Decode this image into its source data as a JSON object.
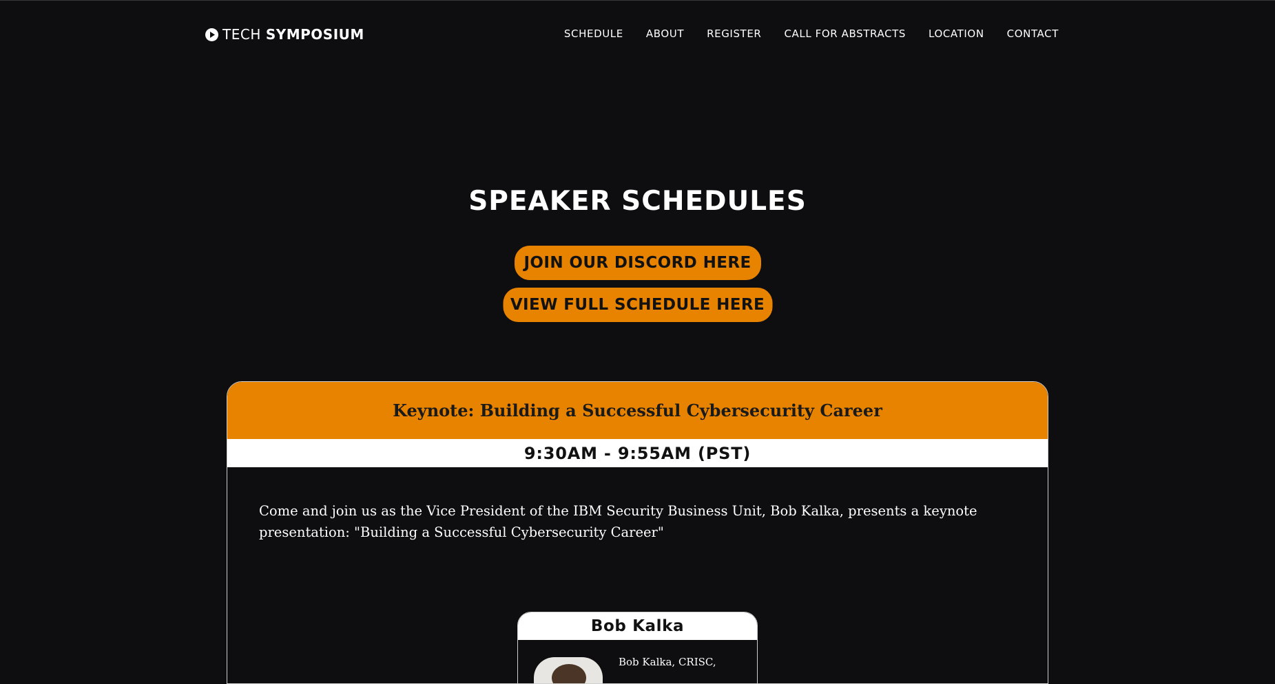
{
  "header": {
    "logo_light": "TECH",
    "logo_bold": "SYMPOSIUM",
    "logo_icon": "play-circle-icon",
    "nav": [
      "SCHEDULE",
      "ABOUT",
      "REGISTER",
      "CALL FOR ABSTRACTS",
      "LOCATION",
      "CONTACT"
    ]
  },
  "main": {
    "title": "SPEAKER SCHEDULES",
    "discord_button": "JOIN OUR DISCORD HERE",
    "schedule_button": "VIEW FULL SCHEDULE HERE"
  },
  "session": {
    "title": "Keynote: Building a Successful Cybersecurity Career",
    "time": "9:30AM - 9:55AM (PST)",
    "description": "Come and join us as the Vice President of the IBM Security Business Unit, Bob Kalka, presents a keynote presentation: \"Building a Successful Cybersecurity Career\"",
    "speaker": {
      "name": "Bob Kalka",
      "bio_start": "Bob Kalka, CRISC,"
    }
  },
  "colors": {
    "accent": "#e88300",
    "background": "#0e0e10",
    "text": "#ffffff"
  }
}
